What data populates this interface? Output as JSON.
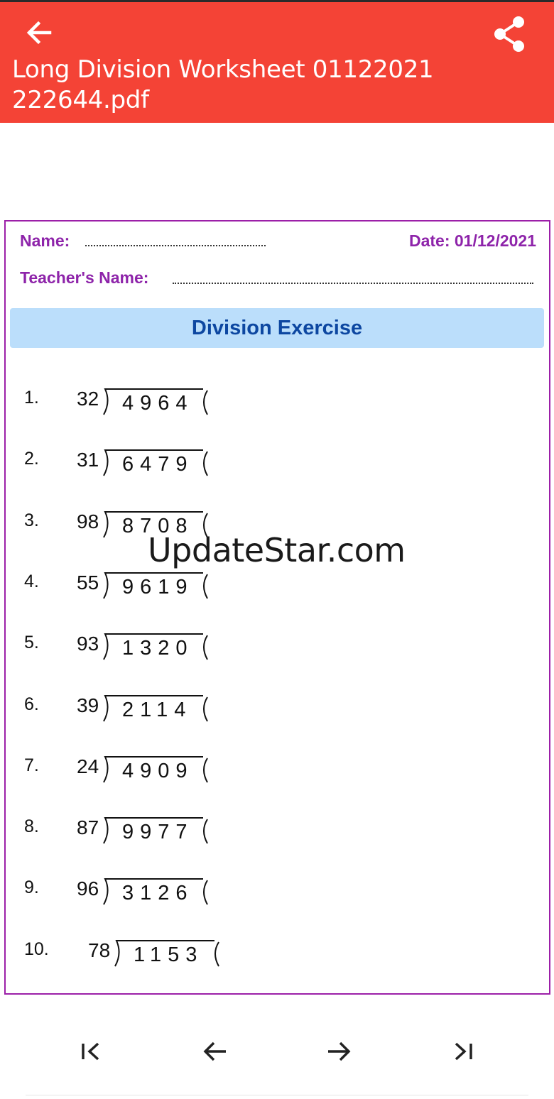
{
  "app_bar": {
    "title": "Long Division Worksheet 01122021 222644.pdf",
    "back_icon": "arrow-left-icon",
    "share_icon": "share-icon",
    "background_color": "#f44336"
  },
  "worksheet": {
    "name_label": "Name:",
    "date_label": "Date: 01/12/2021",
    "teacher_label": "Teacher's Name:",
    "banner_title": "Division Exercise",
    "label_color": "#8e24aa",
    "banner_color": "#bbdefb",
    "problems": [
      {
        "number": "1.",
        "divisor": "32",
        "dividend": "4964"
      },
      {
        "number": "2.",
        "divisor": "31",
        "dividend": "6479"
      },
      {
        "number": "3.",
        "divisor": "98",
        "dividend": "8708"
      },
      {
        "number": "4.",
        "divisor": "55",
        "dividend": "9619"
      },
      {
        "number": "5.",
        "divisor": "93",
        "dividend": "1320"
      },
      {
        "number": "6.",
        "divisor": "39",
        "dividend": "2114"
      },
      {
        "number": "7.",
        "divisor": "24",
        "dividend": "4909"
      },
      {
        "number": "8.",
        "divisor": "87",
        "dividend": "9977"
      },
      {
        "number": "9.",
        "divisor": "96",
        "dividend": "3126"
      },
      {
        "number": "10.",
        "divisor": "78",
        "dividend": "1153"
      }
    ]
  },
  "watermark": "UpdateStar.com",
  "page_nav": {
    "first_icon": "first-page-icon",
    "prev_icon": "arrow-left-icon",
    "next_icon": "arrow-right-icon",
    "last_icon": "last-page-icon"
  }
}
